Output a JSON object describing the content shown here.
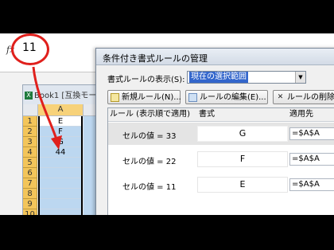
{
  "formula_bar": {
    "fx": "fx",
    "value": "11"
  },
  "workbook": {
    "title": "Book1 [互換モー",
    "col_header": "A",
    "rows": [
      {
        "num": "1",
        "value": "E"
      },
      {
        "num": "2",
        "value": "F"
      },
      {
        "num": "3",
        "value": "G"
      },
      {
        "num": "4",
        "value": "44"
      },
      {
        "num": "5",
        "value": ""
      },
      {
        "num": "6",
        "value": ""
      },
      {
        "num": "7",
        "value": ""
      },
      {
        "num": "8",
        "value": ""
      },
      {
        "num": "9",
        "value": ""
      },
      {
        "num": "10",
        "value": ""
      }
    ]
  },
  "dialog": {
    "title": "条件付き書式ルールの管理",
    "show_label": "書式ルールの表示(S):",
    "show_value": "現在の選択範囲",
    "buttons": {
      "new": "新規ルール(N)...",
      "edit": "ルールの編集(E)...",
      "delete": "ルールの削除(D)"
    },
    "columns": {
      "rule": "ルール (表示順で適用)",
      "format": "書式",
      "applies_to": "適用先"
    },
    "rules": [
      {
        "rule": "セルの値 = 33",
        "format": "G",
        "applies_to": "=$A$A",
        "selected": true
      },
      {
        "rule": "セルの値 = 22",
        "format": "F",
        "applies_to": "=$A$A",
        "selected": false
      },
      {
        "rule": "セルの値 = 11",
        "format": "E",
        "applies_to": "=$A$A",
        "selected": false
      }
    ]
  },
  "colors": {
    "annotation": "#e0201c",
    "selection": "#bcd7f0",
    "row_header": "#f3c55a"
  }
}
